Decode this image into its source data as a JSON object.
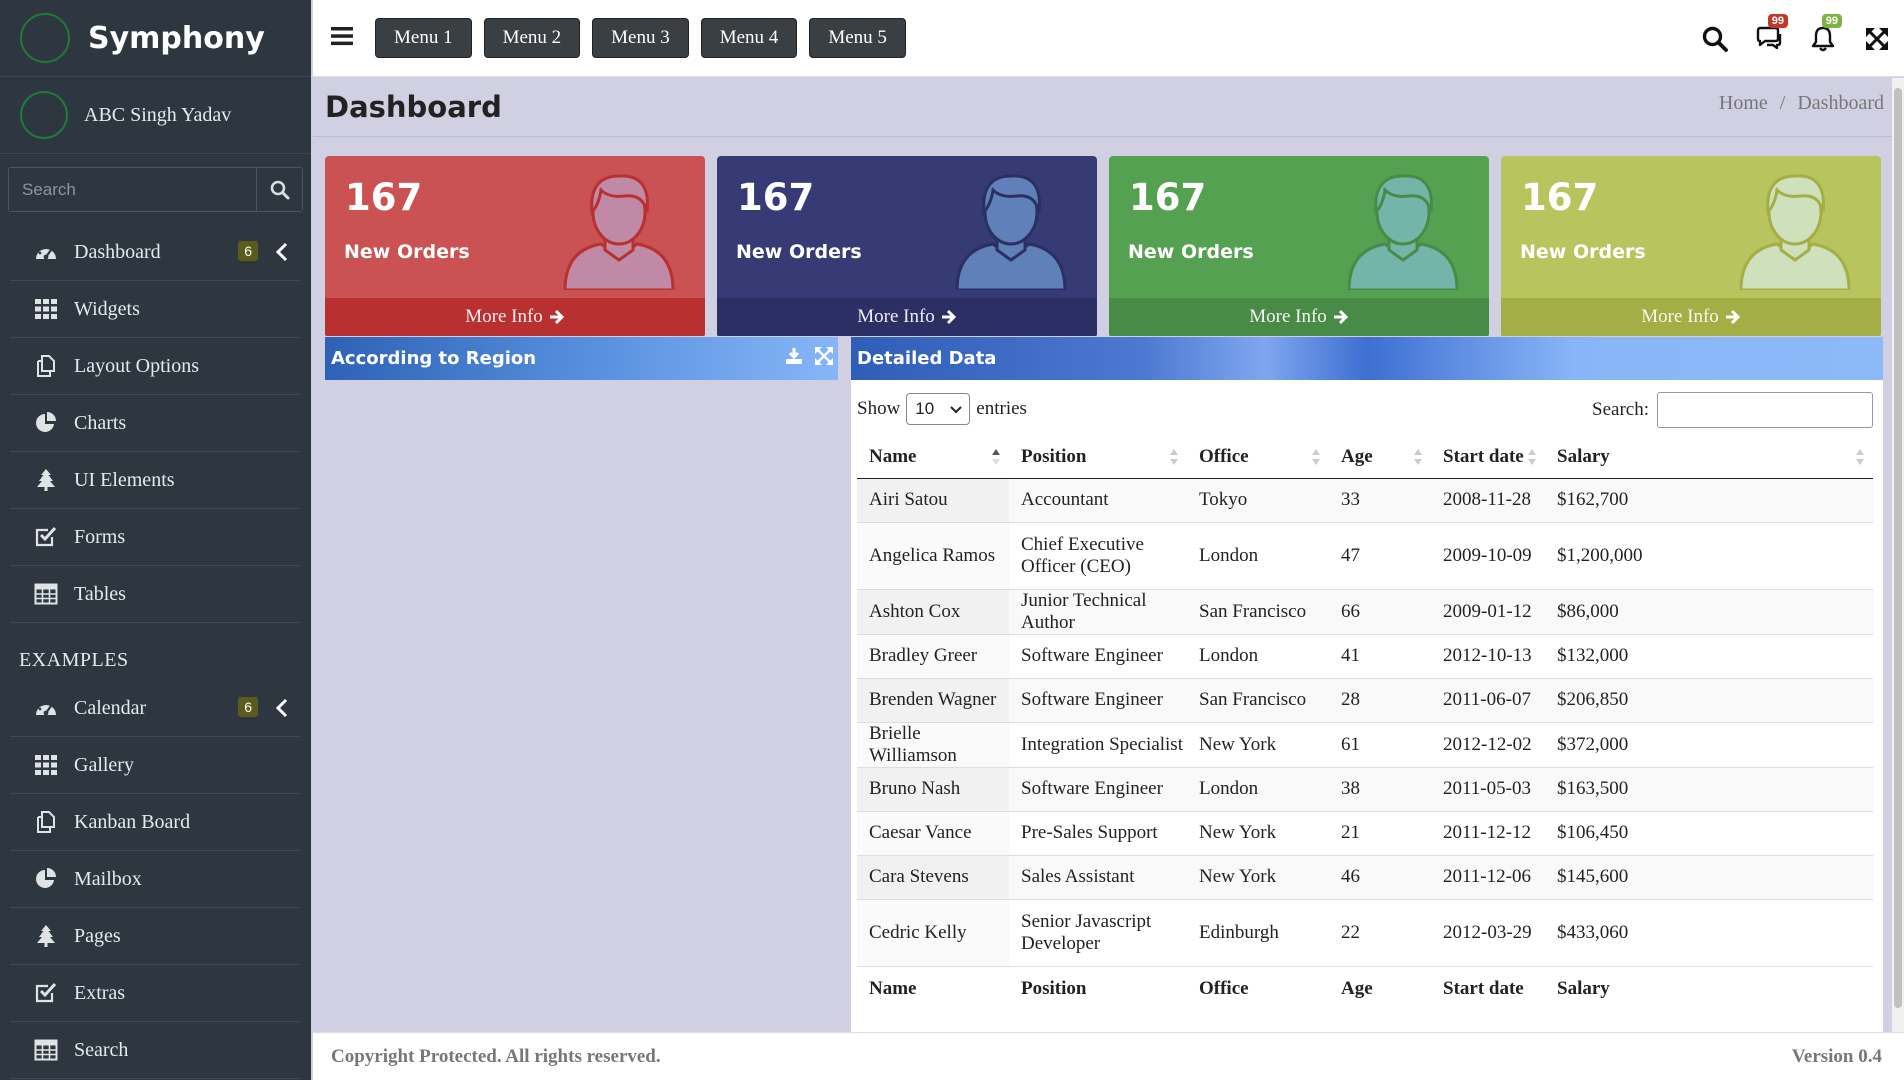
{
  "app": {
    "brand": "Symphony",
    "user_name": "ABC Singh Yadav"
  },
  "sidebar": {
    "search_placeholder": "Search",
    "items": [
      {
        "label": "Dashboard",
        "icon": "dashboard-icon",
        "badge": "6"
      },
      {
        "label": "Widgets",
        "icon": "grid-icon"
      },
      {
        "label": "Layout Options",
        "icon": "copy-icon"
      },
      {
        "label": "Charts",
        "icon": "pie-chart-icon"
      },
      {
        "label": "UI Elements",
        "icon": "tree-icon"
      },
      {
        "label": "Forms",
        "icon": "check-square-icon"
      },
      {
        "label": "Tables",
        "icon": "table-icon"
      }
    ],
    "section_label": "EXAMPLES",
    "examples": [
      {
        "label": "Calendar",
        "icon": "dashboard-icon",
        "badge": "6"
      },
      {
        "label": "Gallery",
        "icon": "grid-icon"
      },
      {
        "label": "Kanban Board",
        "icon": "copy-icon"
      },
      {
        "label": "Mailbox",
        "icon": "pie-chart-icon"
      },
      {
        "label": "Pages",
        "icon": "tree-icon"
      },
      {
        "label": "Extras",
        "icon": "check-square-icon"
      },
      {
        "label": "Search",
        "icon": "table-icon"
      }
    ]
  },
  "topbar": {
    "menus": [
      "Menu 1",
      "Menu 2",
      "Menu 3",
      "Menu 4",
      "Menu 5"
    ],
    "messages_badge": "99",
    "notifications_badge": "99",
    "badge_colors": {
      "messages": "#c0392b",
      "notifications": "#7cb342"
    }
  },
  "page": {
    "title": "Dashboard",
    "breadcrumb": [
      "Home",
      "/",
      "Dashboard"
    ]
  },
  "cards": [
    {
      "value": "167",
      "label": "New Orders",
      "more": "More Info",
      "bg": "#cb5252",
      "footer_bg": "#b8302f",
      "accent": "#c08aa6"
    },
    {
      "value": "167",
      "label": "New Orders",
      "more": "More Info",
      "bg": "#363a75",
      "footer_bg": "#2b2f63",
      "accent": "#5f80b8"
    },
    {
      "value": "167",
      "label": "New Orders",
      "more": "More Info",
      "bg": "#55a152",
      "footer_bg": "#4a8a47",
      "accent": "#73b5a8"
    },
    {
      "value": "167",
      "label": "New Orders",
      "more": "More Info",
      "bg": "#b8c45e",
      "footer_bg": "#a3ae44",
      "accent": "#cfe0bd"
    }
  ],
  "region_panel": {
    "title": "According to Region"
  },
  "detail_panel": {
    "title": "Detailed Data",
    "show_label": "Show",
    "entries_value": "10",
    "entries_label": "entries",
    "search_label": "Search:",
    "columns": [
      "Name",
      "Position",
      "Office",
      "Age",
      "Start date",
      "Salary"
    ],
    "rows": [
      [
        "Airi Satou",
        "Accountant",
        "Tokyo",
        "33",
        "2008-11-28",
        "$162,700"
      ],
      [
        "Angelica Ramos",
        "Chief Executive Officer (CEO)",
        "London",
        "47",
        "2009-10-09",
        "$1,200,000"
      ],
      [
        "Ashton Cox",
        "Junior Technical Author",
        "San Francisco",
        "66",
        "2009-01-12",
        "$86,000"
      ],
      [
        "Bradley Greer",
        "Software Engineer",
        "London",
        "41",
        "2012-10-13",
        "$132,000"
      ],
      [
        "Brenden Wagner",
        "Software Engineer",
        "San Francisco",
        "28",
        "2011-06-07",
        "$206,850"
      ],
      [
        "Brielle Williamson",
        "Integration Specialist",
        "New York",
        "61",
        "2012-12-02",
        "$372,000"
      ],
      [
        "Bruno Nash",
        "Software Engineer",
        "London",
        "38",
        "2011-05-03",
        "$163,500"
      ],
      [
        "Caesar Vance",
        "Pre-Sales Support",
        "New York",
        "21",
        "2011-12-12",
        "$106,450"
      ],
      [
        "Cara Stevens",
        "Sales Assistant",
        "New York",
        "46",
        "2011-12-06",
        "$145,600"
      ],
      [
        "Cedric Kelly",
        "Senior Javascript Developer",
        "Edinburgh",
        "22",
        "2012-03-29",
        "$433,060"
      ]
    ]
  },
  "footer": {
    "copyright": "Copyright Protected. All rights reserved.",
    "version": "Version 0.4"
  }
}
